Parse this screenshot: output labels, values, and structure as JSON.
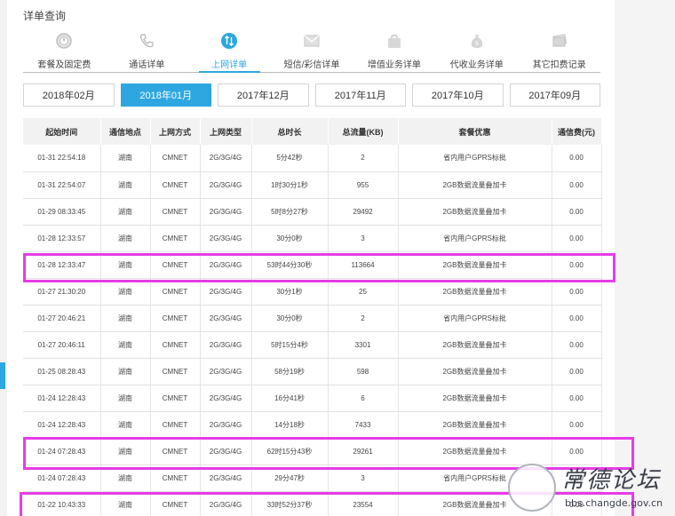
{
  "title": "详单查询",
  "tabs": [
    {
      "label": "套餐及固定费",
      "icon": "clock-icon",
      "active": false
    },
    {
      "label": "通话详单",
      "icon": "phone-icon",
      "active": false
    },
    {
      "label": "上网详单",
      "icon": "data-arrows-icon",
      "active": true
    },
    {
      "label": "短信/彩信详单",
      "icon": "envelope-icon",
      "active": false
    },
    {
      "label": "增值业务详单",
      "icon": "bag-icon",
      "active": false
    },
    {
      "label": "代收业务详单",
      "icon": "money-bag-icon",
      "active": false
    },
    {
      "label": "其它扣费记录",
      "icon": "card-icon",
      "active": false
    }
  ],
  "months": [
    {
      "label": "2018年02月",
      "active": false
    },
    {
      "label": "2018年01月",
      "active": true
    },
    {
      "label": "2017年12月",
      "active": false
    },
    {
      "label": "2017年11月",
      "active": false
    },
    {
      "label": "2017年10月",
      "active": false
    },
    {
      "label": "2017年09月",
      "active": false
    }
  ],
  "table": {
    "headers": [
      "起始时间",
      "通信地点",
      "上网方式",
      "上网类型",
      "总时长",
      "总流量(KB)",
      "套餐优惠",
      "通信费(元)"
    ],
    "rows": [
      [
        "01-31 22:54:18",
        "湖南",
        "CMNET",
        "2G/3G/4G",
        "5分42秒",
        "2",
        "省内用户GPRS标批",
        "0.00"
      ],
      [
        "01-31 22:54:07",
        "湖南",
        "CMNET",
        "2G/3G/4G",
        "1时30分1秒",
        "955",
        "2GB数据流量叠加卡",
        "0.00"
      ],
      [
        "01-29 08:33:45",
        "湖南",
        "CMNET",
        "2G/3G/4G",
        "5时8分27秒",
        "29492",
        "2GB数据流量叠加卡",
        "0.00"
      ],
      [
        "01-28 12:33:57",
        "湖南",
        "CMNET",
        "2G/3G/4G",
        "30分0秒",
        "3",
        "省内用户GPRS标批",
        "0.00"
      ],
      [
        "01-28 12:33:47",
        "湖南",
        "CMNET",
        "2G/3G/4G",
        "53时44分30秒",
        "113664",
        "2GB数据流量叠加卡",
        "0.00"
      ],
      [
        "01-27 21:30:20",
        "湖南",
        "CMNET",
        "2G/3G/4G",
        "30分1秒",
        "25",
        "2GB数据流量叠加卡",
        "0.00"
      ],
      [
        "01-27 20:46:21",
        "湖南",
        "CMNET",
        "2G/3G/4G",
        "30分0秒",
        "2",
        "省内用户GPRS标批",
        "0.00"
      ],
      [
        "01-27 20:46:11",
        "湖南",
        "CMNET",
        "2G/3G/4G",
        "5时15分4秒",
        "3301",
        "2GB数据流量叠加卡",
        "0.00"
      ],
      [
        "01-25 08:28:43",
        "湖南",
        "CMNET",
        "2G/3G/4G",
        "58分19秒",
        "598",
        "2GB数据流量叠加卡",
        "0.00"
      ],
      [
        "01-24 12:28:43",
        "湖南",
        "CMNET",
        "2G/3G/4G",
        "16分41秒",
        "6",
        "2GB数据流量叠加卡",
        "0.00"
      ],
      [
        "01-24 12:28:43",
        "湖南",
        "CMNET",
        "2G/3G/4G",
        "14分18秒",
        "7433",
        "2GB数据流量叠加卡",
        "0.00"
      ],
      [
        "01-24 07:28:43",
        "湖南",
        "CMNET",
        "2G/3G/4G",
        "62时15分43秒",
        "29261",
        "2GB数据流量叠加卡",
        "0.00"
      ],
      [
        "01-24 07:28:43",
        "湖南",
        "CMNET",
        "2G/3G/4G",
        "29分47秒",
        "3",
        "省内用户GPRS标批",
        "0.00"
      ],
      [
        "01-22 10:43:33",
        "湖南",
        "CMNET",
        "2G/3G/4G",
        "33时52分37秒",
        "23554",
        "2GB数据流量叠加卡",
        "0.00"
      ]
    ]
  },
  "watermark": {
    "name": "常德论坛",
    "url": "bbs.changde.gov.cn"
  },
  "colors": {
    "accent": "#2ea7e0",
    "highlight": "#e63ce6"
  }
}
